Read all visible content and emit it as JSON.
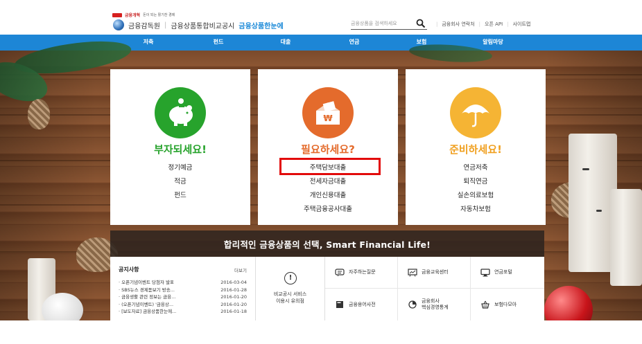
{
  "header": {
    "small_brand": "금융개혁",
    "small_tagline": "돈이 되는 활기찬 경제",
    "org_name": "금융감독원",
    "separator": "|",
    "service_name": "금융상품통합비교공시",
    "site_name": "금융상품한눈에",
    "search": {
      "placeholder": "금융상품을 검색하세요",
      "icon": "search-icon"
    },
    "links": [
      "금융회사 연락처",
      "오픈 API",
      "사이트맵"
    ]
  },
  "nav": {
    "items": [
      "저축",
      "펀드",
      "대출",
      "연금",
      "보험",
      "알림마당"
    ],
    "color": "#1d86d6"
  },
  "cards": [
    {
      "title": "부자되세요!",
      "title_color": "#27a32c",
      "circle_color": "#27a32c",
      "icon": "piggy-bank-icon",
      "items": [
        "정기예금",
        "적금",
        "펀드"
      ]
    },
    {
      "title": "필요하세요?",
      "title_color": "#e46b2c",
      "circle_color": "#e46b2c",
      "icon": "won-envelope-icon",
      "items": [
        "주택담보대출",
        "전세자금대출",
        "개인신용대출",
        "주택금융공사대출"
      ],
      "highlighted_item": "주택담보대출"
    },
    {
      "title": "준비하세요!",
      "title_color": "#f0a020",
      "circle_color": "#f5b434",
      "icon": "umbrella-icon",
      "items": [
        "연금저축",
        "퇴직연금",
        "실손의료보험",
        "자동차보험"
      ]
    }
  ],
  "slogan": "합리적인 금융상품의 선택, Smart Financial Life!",
  "notice": {
    "title": "공지사항",
    "more": "더보기",
    "rows": [
      {
        "text": "· 오픈기념이벤트 당첨자 발표",
        "date": "2016-03-04"
      },
      {
        "text": "· SBS뉴스 경제돋보기 방송...",
        "date": "2016-01-28"
      },
      {
        "text": "· 금융생활 관련 정보는 금융...",
        "date": "2016-01-20"
      },
      {
        "text": "· (오픈기념이벤트) '금융상...",
        "date": "2016-01-20"
      },
      {
        "text": "· [보도자료] 금융상품한눈에...",
        "date": "2016-01-18"
      }
    ]
  },
  "service_notice": {
    "icon": "exclamation-icon",
    "line1": "비교공시 서비스",
    "line2": "이용시 유의점"
  },
  "quick_links": [
    {
      "label": "자주하는질문",
      "icon": "faq-icon"
    },
    {
      "label": "금융교육센터",
      "icon": "education-icon"
    },
    {
      "label": "연금포털",
      "icon": "monitor-icon"
    },
    {
      "label": "금융용어사전",
      "icon": "dictionary-icon"
    },
    {
      "label_line1": "금융회사",
      "label_line2": "핵심경영통계",
      "icon": "pie-chart-icon"
    },
    {
      "label": "보험다모아",
      "icon": "basket-icon"
    }
  ]
}
